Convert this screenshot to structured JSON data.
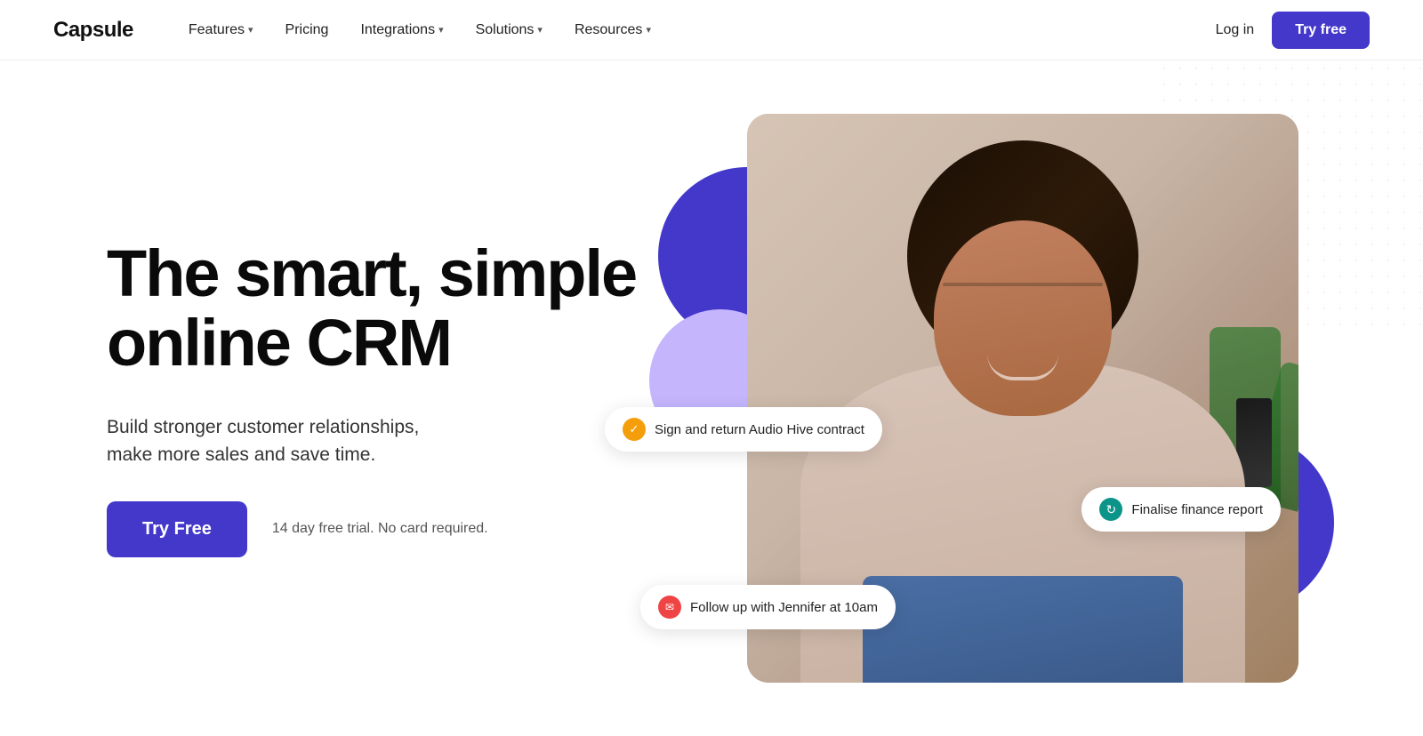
{
  "nav": {
    "logo": "Capsule",
    "links": [
      {
        "label": "Features",
        "hasDropdown": true
      },
      {
        "label": "Pricing",
        "hasDropdown": false
      },
      {
        "label": "Integrations",
        "hasDropdown": true
      },
      {
        "label": "Solutions",
        "hasDropdown": true
      },
      {
        "label": "Resources",
        "hasDropdown": true
      }
    ],
    "login_label": "Log in",
    "try_free_label": "Try free"
  },
  "hero": {
    "headline_line1": "The smart, simple",
    "headline_line2": "online CRM",
    "subtext_line1": "Build stronger customer relationships,",
    "subtext_line2": "make more sales and save time.",
    "cta_button": "Try Free",
    "trial_text": "14 day free trial. No card required."
  },
  "pills": {
    "pill1": {
      "icon": "✓",
      "icon_class": "pill-yellow",
      "text": "Sign and return Audio Hive contract"
    },
    "pill2": {
      "icon": "↻",
      "icon_class": "pill-teal",
      "text": "Finalise finance report"
    },
    "pill3": {
      "icon": "✉",
      "icon_class": "pill-red",
      "text": "Follow up with Jennifer at 10am"
    }
  },
  "colors": {
    "accent": "#4338ca",
    "accent_hover": "#3730a3"
  }
}
